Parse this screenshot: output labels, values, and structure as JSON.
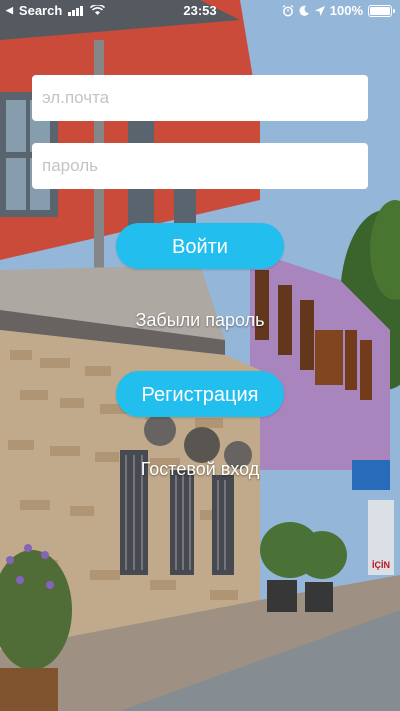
{
  "status_bar": {
    "carrier": "Search",
    "time": "23:53",
    "battery": "100%",
    "back_glyph": "◀",
    "icons": [
      "signal-bars-icon",
      "wifi-icon",
      "alarm-icon",
      "moon-icon",
      "location-arrow-icon",
      "battery-icon"
    ]
  },
  "login_form": {
    "email_placeholder": "эл.почта",
    "password_placeholder": "пароль",
    "login_label": "Войти",
    "forgot_password_label": "Забыли пароль",
    "register_label": "Регистрация",
    "guest_login_label": "Гостевой вход"
  },
  "background": {
    "shop_sign": "İÇİN"
  },
  "colors": {
    "accent": "#22bfee",
    "field_bg": "#ffffff",
    "text_on_image": "#ffffff"
  }
}
